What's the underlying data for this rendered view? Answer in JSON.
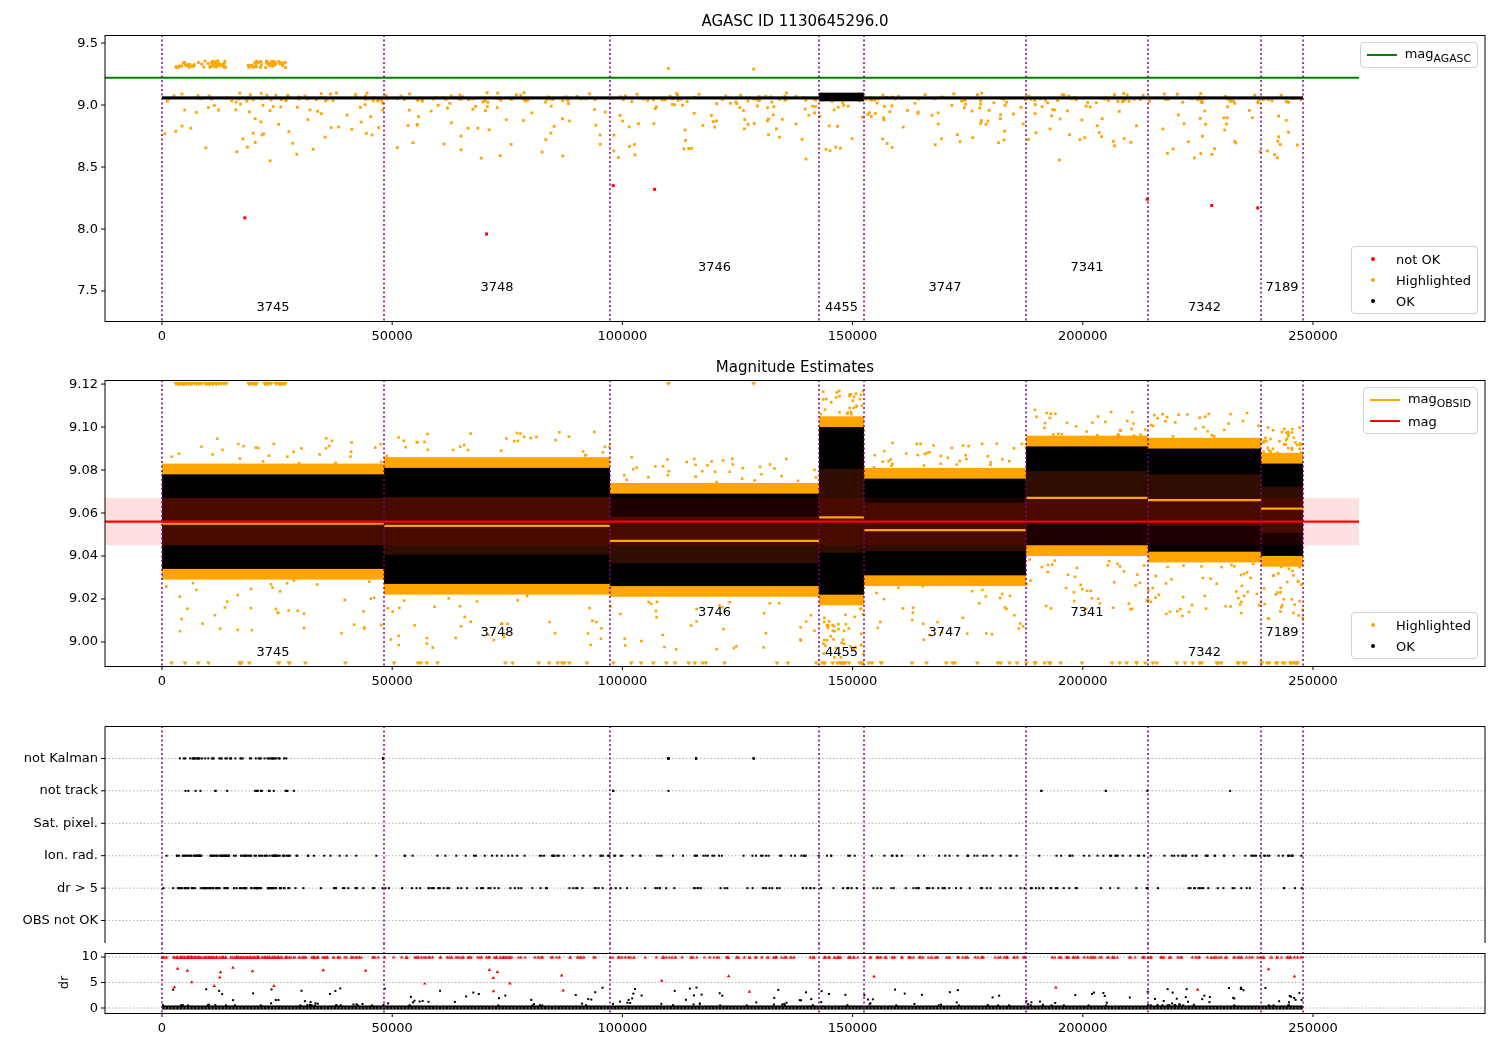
{
  "panels": [
    {
      "kind": "overview",
      "chart_data": {
        "type": "scatter",
        "title": "AGASC ID 1130645296.0",
        "xlim": [
          -12380,
          287360
        ],
        "ylim": [
          7.258,
          9.565
        ],
        "xticks": [
          0,
          50000,
          100000,
          150000,
          200000,
          250000
        ],
        "yticks": [
          {
            "value": 7.5,
            "label": "7.5"
          },
          {
            "value": 8.0,
            "label": "8.0"
          },
          {
            "value": 8.5,
            "label": "8.5"
          },
          {
            "value": 9.0,
            "label": "9.0"
          },
          {
            "value": 9.5,
            "label": "9.5"
          }
        ],
        "ref_lines": [
          {
            "axis": "x",
            "value": 0
          },
          {
            "axis": "x",
            "value": 48220
          },
          {
            "axis": "x",
            "value": 97300
          },
          {
            "axis": "x",
            "value": 142700
          },
          {
            "axis": "x",
            "value": 152480
          },
          {
            "axis": "x",
            "value": 187670
          },
          {
            "axis": "x",
            "value": 214170
          },
          {
            "axis": "x",
            "value": 238720
          },
          {
            "axis": "x",
            "value": 247840
          }
        ],
        "series": [
          {
            "type": "scatter",
            "color": "#ff0000",
            "x": [
              18000,
              70500,
              98000,
              107000,
              214000,
              228000,
              238000
            ],
            "values": [
              8.09,
              7.96,
              8.35,
              8.32,
              8.24,
              8.19,
              8.17
            ]
          },
          {
            "type": "line",
            "color": "#008000",
            "x": [
              -12380,
              260000
            ],
            "values": [
              9.22,
              9.22
            ]
          }
        ],
        "annotations": [
          "3745",
          "3748",
          "3746",
          "4455",
          "3747",
          "7341",
          "7342",
          "7189"
        ]
      },
      "legends": [
        {
          "entries": [
            {
              "label": "mag$_{AGASC}$",
              "kind": "line",
              "color": "#008000"
            }
          ]
        },
        {
          "entries": [
            {
              "label": "not OK",
              "kind": "dot",
              "color": "#ff0000"
            },
            {
              "label": "Highlighted",
              "kind": "dot",
              "color": "#ffa500"
            },
            {
              "label": "OK",
              "kind": "dot",
              "color": "#000000"
            }
          ]
        }
      ]
    },
    {
      "kind": "estimates",
      "chart_data": {
        "type": "scatter",
        "title": "Magnitude Estimates",
        "xlim": [
          -12380,
          287360
        ],
        "ylim": [
          8.9888,
          9.1219
        ],
        "xticks": [
          0,
          50000,
          100000,
          150000,
          200000,
          250000
        ],
        "yticks": [
          {
            "value": 9.0,
            "label": "9.00"
          },
          {
            "value": 9.02,
            "label": "9.02"
          },
          {
            "value": 9.04,
            "label": "9.04"
          },
          {
            "value": 9.06,
            "label": "9.06"
          },
          {
            "value": 9.08,
            "label": "9.08"
          },
          {
            "value": 9.1,
            "label": "9.10"
          },
          {
            "value": 9.12,
            "label": "9.12"
          }
        ],
        "ref_lines": [
          {
            "axis": "x",
            "value": 0
          },
          {
            "axis": "x",
            "value": 48220
          },
          {
            "axis": "x",
            "value": 97300
          },
          {
            "axis": "x",
            "value": 142700
          },
          {
            "axis": "x",
            "value": 152480
          },
          {
            "axis": "x",
            "value": 187670
          },
          {
            "axis": "x",
            "value": 214170
          },
          {
            "axis": "x",
            "value": 238720
          },
          {
            "axis": "x",
            "value": 247840
          }
        ],
        "bands": [
          {
            "axis": "y",
            "from": 9.045,
            "to": 9.067,
            "color": "#ff0000"
          }
        ],
        "series": [
          {
            "type": "line",
            "color": "#ffa500",
            "x": [
              0,
              48220,
              null,
              48220,
              97300,
              null,
              97300,
              142700,
              null,
              142700,
              152480,
              null,
              152480,
              187670,
              null,
              187670,
              214170,
              null,
              214170,
              238720,
              null,
              238720,
              247840
            ],
            "values": [
              9.055,
              9.055,
              null,
              9.054,
              9.054,
              null,
              9.047,
              9.047,
              null,
              9.058,
              9.058,
              null,
              9.052,
              9.052,
              null,
              9.067,
              9.067,
              null,
              9.066,
              9.066,
              null,
              9.062,
              9.062
            ]
          },
          {
            "type": "line",
            "color": "#ff0000",
            "x": [
              -12380,
              260000
            ],
            "values": [
              9.056,
              9.056
            ]
          }
        ],
        "annotations": [
          "3745",
          "3748",
          "3746",
          "4455",
          "3747",
          "7341",
          "7342",
          "7189"
        ]
      },
      "legends": [
        {
          "entries": [
            {
              "label": "mag$_{OBSID}$",
              "kind": "line",
              "color": "#ffa500"
            },
            {
              "label": "mag",
              "kind": "line",
              "color": "#ff0000"
            }
          ]
        },
        {
          "entries": [
            {
              "label": "Highlighted",
              "kind": "dot",
              "color": "#ffa500"
            },
            {
              "label": "OK",
              "kind": "dot",
              "color": "#000000"
            }
          ]
        }
      ]
    },
    {
      "kind": "flags",
      "rows": [
        {
          "label": "not Kalman",
          "kind": "sparse"
        },
        {
          "label": "not track",
          "kind": "scattered"
        },
        {
          "label": "Sat. pixel.",
          "kind": "empty"
        },
        {
          "label": "Ion. rad.",
          "kind": "dense"
        },
        {
          "label": "dr > 5",
          "kind": "dense"
        },
        {
          "label": "OBS not OK",
          "kind": "empty"
        }
      ],
      "chart_data": {
        "type": "scatter",
        "ylabel": "dr",
        "grid": true,
        "xlim": [
          -12380,
          287360
        ],
        "ylim": [
          -0.98,
          10.78
        ],
        "xticks": [
          0,
          50000,
          100000,
          150000,
          200000,
          250000
        ],
        "yticks": [
          {
            "value": 0,
            "label": "0"
          },
          {
            "value": 5,
            "label": "5"
          },
          {
            "value": 10,
            "label": "10"
          }
        ],
        "ref_lines": [
          {
            "axis": "x",
            "value": 0
          },
          {
            "axis": "x",
            "value": 48220
          },
          {
            "axis": "x",
            "value": 97300
          },
          {
            "axis": "x",
            "value": 142700
          },
          {
            "axis": "x",
            "value": 152480
          },
          {
            "axis": "x",
            "value": 187670
          },
          {
            "axis": "x",
            "value": 214170
          },
          {
            "axis": "x",
            "value": 238720
          },
          {
            "axis": "x",
            "value": 247840
          }
        ]
      }
    }
  ]
}
